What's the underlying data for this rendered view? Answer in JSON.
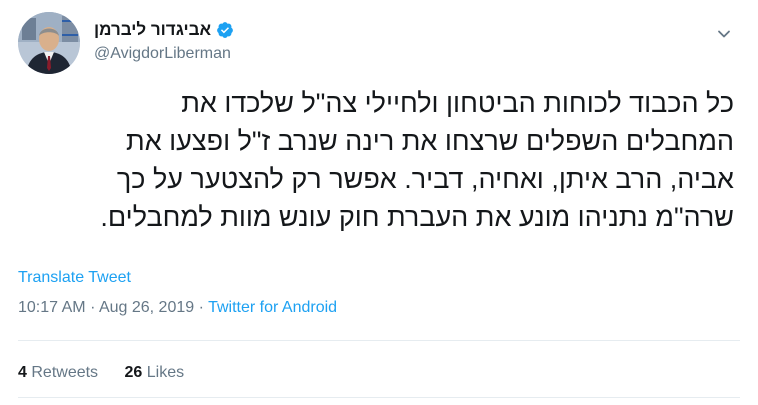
{
  "author": {
    "display_name": "אביגדור ליברמן",
    "handle": "@AvigdorLiberman",
    "verified": true
  },
  "tweet": {
    "lines": [
      "כל הכבוד לכוחות הביטחון ולחיילי צה\"ל שלכדו את",
      "המחבלים השפלים שרצחו את רינה שנרב ז\"ל ופצעו את",
      "אביה, הרב איתן, ואחיה, דביר. אפשר רק להצטער על כך",
      "שרה\"מ נתניהו מונע את העברת חוק עונש מוות למחבלים."
    ],
    "translate_label": "Translate Tweet",
    "time": "10:17 AM",
    "separator": "·",
    "date": "Aug 26, 2019",
    "source": "Twitter for Android"
  },
  "stats": {
    "retweets_count": "4",
    "retweets_label": "Retweets",
    "likes_count": "26",
    "likes_label": "Likes"
  },
  "colors": {
    "link_blue": "#1da1f2",
    "secondary_gray": "#657786",
    "text_dark": "#14171a"
  },
  "icons": {
    "verified": "verified-badge-icon",
    "menu": "chevron-down-icon"
  }
}
